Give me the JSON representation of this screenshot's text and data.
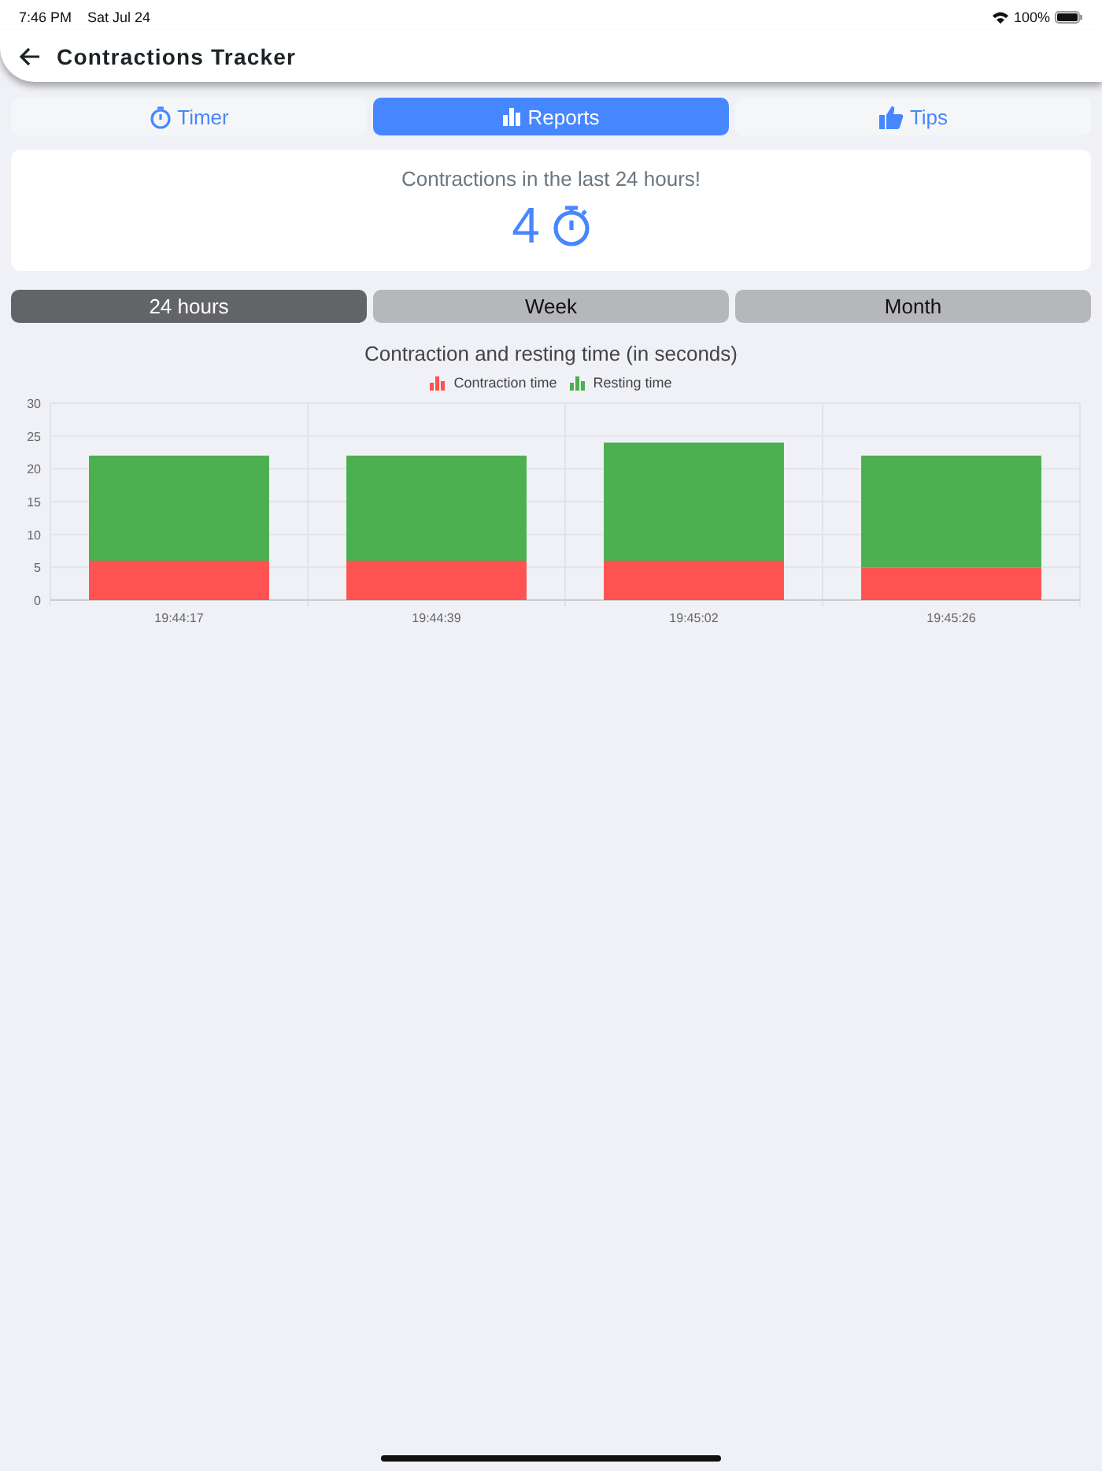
{
  "status_bar": {
    "time": "7:46 PM",
    "date": "Sat Jul 24",
    "battery": "100%"
  },
  "header": {
    "title": "Contractions Tracker"
  },
  "tabs": [
    {
      "label": "Timer",
      "kind": "timer",
      "selected": false
    },
    {
      "label": "Reports",
      "kind": "chart",
      "selected": true
    },
    {
      "label": "Tips",
      "kind": "thumb",
      "selected": false
    }
  ],
  "summary": {
    "caption": "Contractions in the last 24 hours!",
    "count": "4"
  },
  "ranges": [
    {
      "label": "24 hours",
      "selected": true
    },
    {
      "label": "Week",
      "selected": false
    },
    {
      "label": "Month",
      "selected": false
    }
  ],
  "chart": {
    "chart_data": {
      "type": "bar",
      "stacked": true,
      "grid": true,
      "title": "Contraction and resting time (in seconds)",
      "categories": [
        "19:44:17",
        "19:44:39",
        "19:45:02",
        "19:45:26"
      ],
      "ylim": [
        0,
        30
      ],
      "yticks": [
        0,
        5,
        10,
        15,
        20,
        25,
        30
      ],
      "series": [
        {
          "name": "Contraction time",
          "color": "#ff5252",
          "values": [
            6,
            6,
            6,
            5
          ]
        },
        {
          "name": "Resting time",
          "color": "#4caf50",
          "values": [
            16,
            16,
            18,
            17
          ]
        }
      ]
    }
  }
}
